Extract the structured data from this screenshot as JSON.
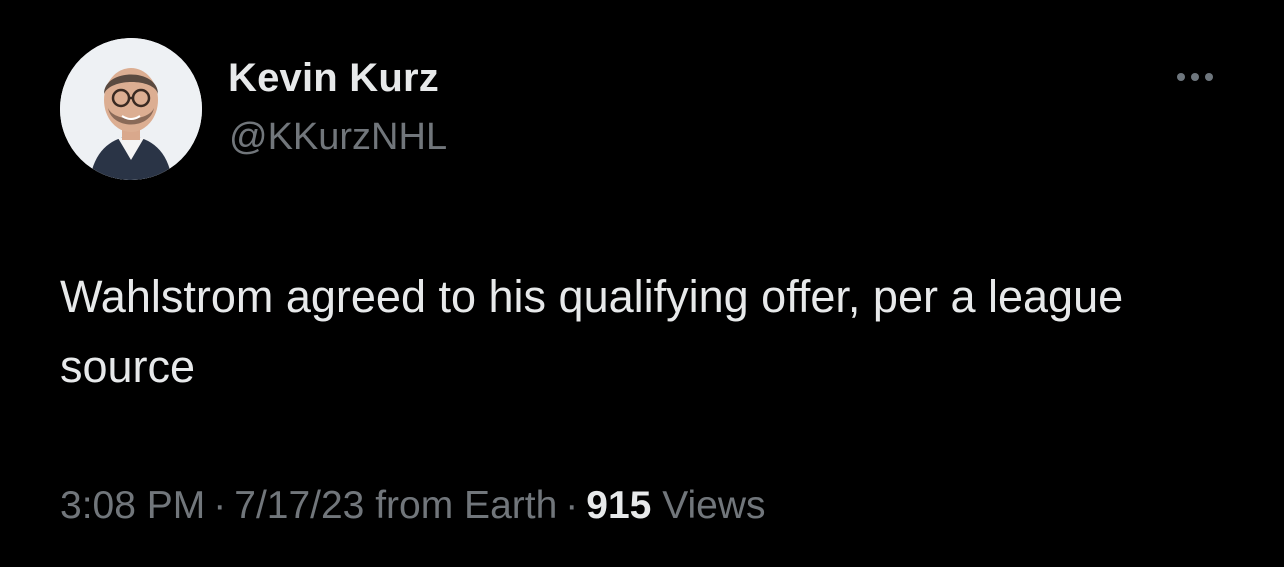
{
  "author": {
    "display_name": "Kevin Kurz",
    "handle": "@KKurzNHL",
    "avatar_icon": "profile-photo"
  },
  "tweet": {
    "text": "Wahlstrom agreed to his qualifying offer, per a league source",
    "time": "3:08 PM",
    "date": "7/17/23",
    "source": "from Earth",
    "separator": "·",
    "views_count": "915",
    "views_label": "Views"
  },
  "more_icon": "more-horizontal-icon",
  "colors": {
    "background": "#000000",
    "primary_text": "#e7e9ea",
    "secondary_text": "#71767b"
  }
}
